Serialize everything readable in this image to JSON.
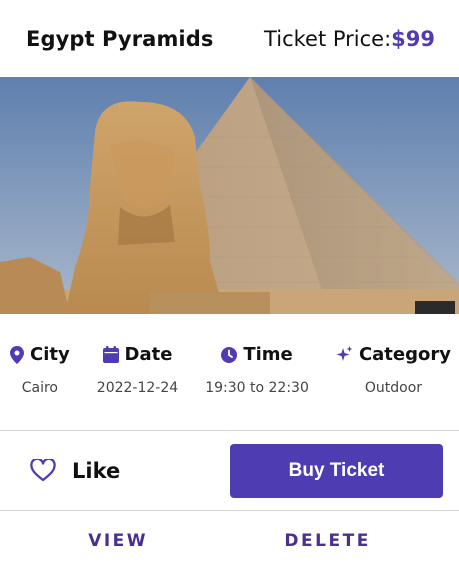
{
  "header": {
    "title": "Egypt Pyramids",
    "price_label": "Ticket Price:",
    "price_value": "$99"
  },
  "details": [
    {
      "label": "City",
      "value": "Cairo",
      "icon": "map-pin-icon"
    },
    {
      "label": "Date",
      "value": "2022-12-24",
      "icon": "calendar-icon"
    },
    {
      "label": "Time",
      "value": "19:30 to 22:30",
      "icon": "clock-icon"
    },
    {
      "label": "Category",
      "value": "Outdoor",
      "icon": "sparkle-icon"
    }
  ],
  "actions": {
    "like_label": "Like",
    "buy_label": "Buy Ticket"
  },
  "footer": {
    "view_label": "VIEW",
    "delete_label": "DELETE"
  },
  "colors": {
    "accent": "#4e3cb3",
    "link": "#4a2e94"
  }
}
